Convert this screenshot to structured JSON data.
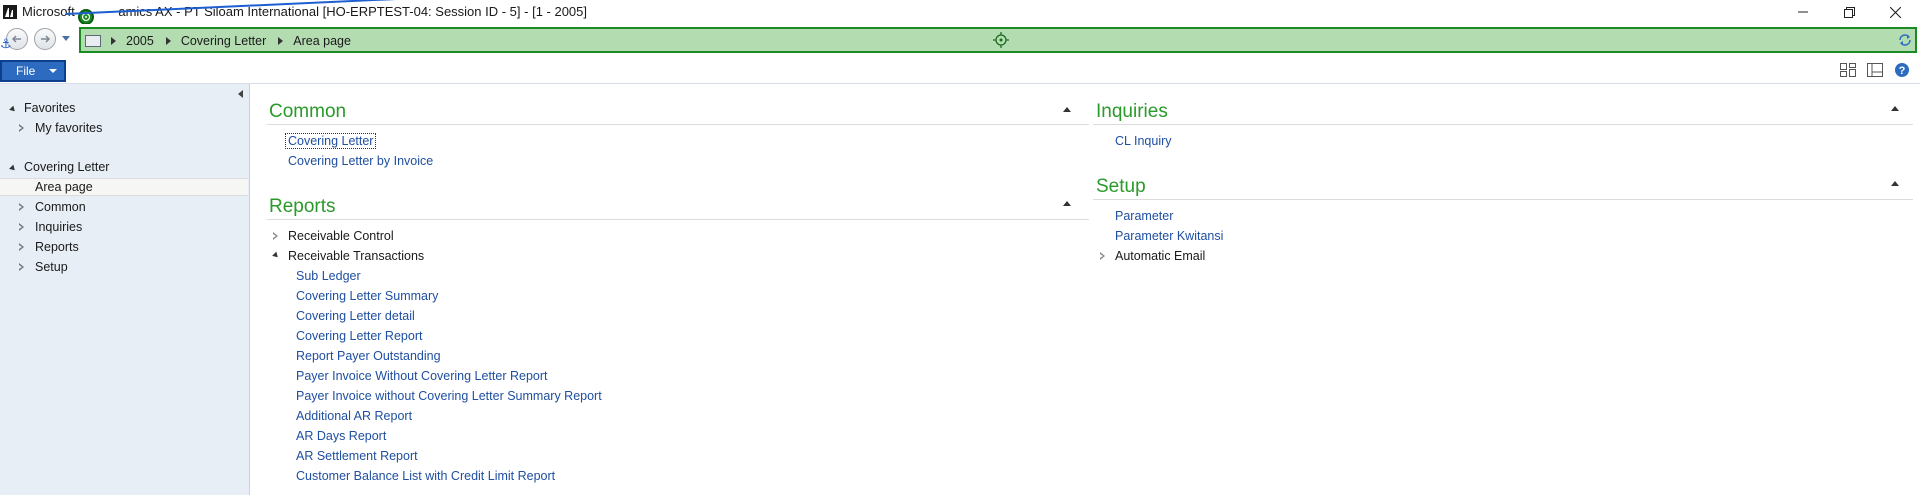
{
  "window": {
    "title": "Microsoft Dynamics AX - PT Siloam International [HO-ERPTEST-04: Session ID - 5] -  [1 - 2005]",
    "title_visible_prefix": "Microsoft ",
    "title_visible_suffix": "amics AX - PT Siloam International [HO-ERPTEST-04: Session ID - 5] -  [1 - 2005]"
  },
  "address_bar": {
    "breadcrumbs": [
      "2005",
      "Covering Letter",
      "Area page"
    ],
    "accent": "#1b8a22",
    "background": "#b3dcb1"
  },
  "file_menu": {
    "label": "File"
  },
  "sidebar": {
    "favorites": {
      "label": "Favorites",
      "items": [
        "My favorites"
      ]
    },
    "module": {
      "label": "Covering Letter",
      "items": [
        {
          "label": "Area page",
          "selected": true,
          "expandable": false
        },
        {
          "label": "Common",
          "expandable": true
        },
        {
          "label": "Inquiries",
          "expandable": true
        },
        {
          "label": "Reports",
          "expandable": true
        },
        {
          "label": "Setup",
          "expandable": true
        }
      ]
    }
  },
  "content": {
    "common": {
      "title": "Common",
      "links": [
        "Covering Letter",
        "Covering Letter by Invoice"
      ]
    },
    "reports": {
      "title": "Reports",
      "groups": [
        {
          "label": "Receivable Control",
          "expanded": false
        },
        {
          "label": "Receivable Transactions",
          "expanded": true
        }
      ],
      "links": [
        "Sub Ledger",
        "Covering Letter Summary",
        "Covering Letter detail",
        "Covering Letter Report",
        "Report Payer Outstanding",
        "Payer Invoice Without Covering Letter Report",
        "Payer Invoice without Covering Letter Summary Report",
        "Additional AR Report",
        "AR Days Report",
        "AR Settlement Report",
        "Customer Balance List with Credit Limit Report"
      ]
    },
    "inquiries": {
      "title": "Inquiries",
      "links": [
        "CL Inquiry"
      ]
    },
    "setup": {
      "title": "Setup",
      "links": [
        "Parameter",
        "Parameter Kwitansi"
      ],
      "groups": [
        {
          "label": "Automatic Email",
          "expanded": false
        }
      ]
    }
  },
  "colors": {
    "section_title": "#2a9a2a",
    "link": "#1f4fa0",
    "sidebar_bg": "#e7eef6",
    "file_button": "#2d6bc0"
  }
}
